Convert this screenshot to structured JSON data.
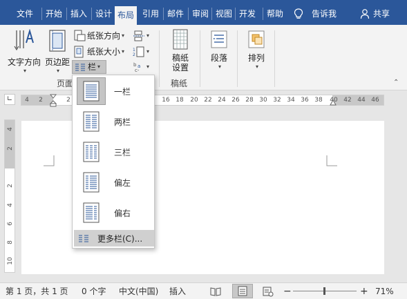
{
  "tabs": [
    "文件",
    "开始",
    "插入",
    "设计",
    "布局",
    "引用",
    "邮件",
    "审阅",
    "视图",
    "开发工具",
    "帮助"
  ],
  "tab_visible": [
    "文件",
    "开始",
    "插入",
    "设计",
    "布局",
    "引用",
    "邮件",
    "审阅",
    "视图",
    "开发",
    "帮助"
  ],
  "active_tab": "布局",
  "tell_me": "告诉我",
  "share": "共享",
  "ribbon": {
    "text_direction": "文字方向",
    "margins": "页边距",
    "orientation": "纸张方向",
    "size": "纸张大小",
    "columns": "栏",
    "page_setup_group": "页面",
    "draft_settings_line1": "稿纸",
    "draft_settings_line2": "设置",
    "draft_group": "稿纸",
    "paragraph": "段落",
    "arrange": "排列"
  },
  "ruler_ticks": [
    "4",
    "2",
    "2",
    "16",
    "18",
    "20",
    "22",
    "24",
    "26",
    "28",
    "30",
    "32",
    "34",
    "36",
    "38",
    "40",
    "42",
    "44",
    "46"
  ],
  "vruler_ticks": [
    "4",
    "2",
    "2",
    "4",
    "6",
    "8",
    "10"
  ],
  "columns_menu": {
    "items": [
      "一栏",
      "两栏",
      "三栏",
      "偏左",
      "偏右"
    ],
    "more": "更多栏(C)..."
  },
  "status": {
    "page": "第 1 页，共 1 页",
    "words": "0 个字",
    "language": "中文(中国)",
    "insert": "插入",
    "zoom": "71%",
    "minus": "−",
    "plus": "+"
  },
  "colors": {
    "accent": "#2b579a"
  }
}
